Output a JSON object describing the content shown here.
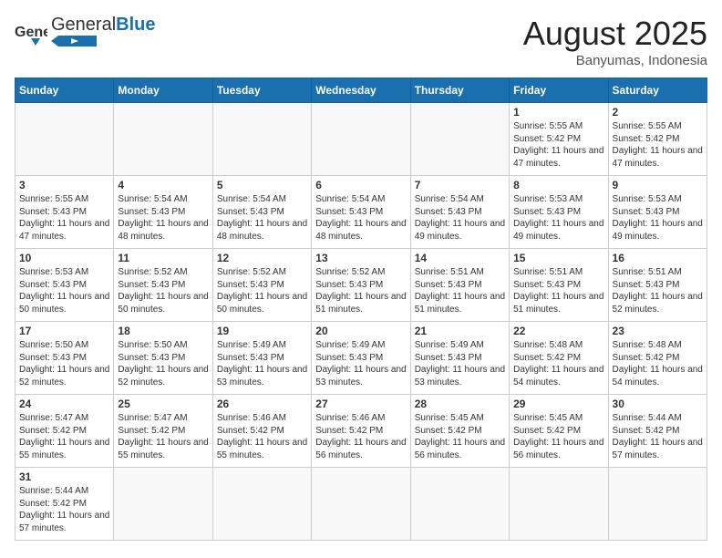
{
  "header": {
    "logo_general": "General",
    "logo_blue": "Blue",
    "month_title": "August 2025",
    "location": "Banyumas, Indonesia"
  },
  "days_of_week": [
    "Sunday",
    "Monday",
    "Tuesday",
    "Wednesday",
    "Thursday",
    "Friday",
    "Saturday"
  ],
  "weeks": [
    [
      {
        "day": "",
        "info": ""
      },
      {
        "day": "",
        "info": ""
      },
      {
        "day": "",
        "info": ""
      },
      {
        "day": "",
        "info": ""
      },
      {
        "day": "",
        "info": ""
      },
      {
        "day": "1",
        "info": "Sunrise: 5:55 AM\nSunset: 5:42 PM\nDaylight: 11 hours and 47 minutes."
      },
      {
        "day": "2",
        "info": "Sunrise: 5:55 AM\nSunset: 5:42 PM\nDaylight: 11 hours and 47 minutes."
      }
    ],
    [
      {
        "day": "3",
        "info": "Sunrise: 5:55 AM\nSunset: 5:43 PM\nDaylight: 11 hours and 47 minutes."
      },
      {
        "day": "4",
        "info": "Sunrise: 5:54 AM\nSunset: 5:43 PM\nDaylight: 11 hours and 48 minutes."
      },
      {
        "day": "5",
        "info": "Sunrise: 5:54 AM\nSunset: 5:43 PM\nDaylight: 11 hours and 48 minutes."
      },
      {
        "day": "6",
        "info": "Sunrise: 5:54 AM\nSunset: 5:43 PM\nDaylight: 11 hours and 48 minutes."
      },
      {
        "day": "7",
        "info": "Sunrise: 5:54 AM\nSunset: 5:43 PM\nDaylight: 11 hours and 49 minutes."
      },
      {
        "day": "8",
        "info": "Sunrise: 5:53 AM\nSunset: 5:43 PM\nDaylight: 11 hours and 49 minutes."
      },
      {
        "day": "9",
        "info": "Sunrise: 5:53 AM\nSunset: 5:43 PM\nDaylight: 11 hours and 49 minutes."
      }
    ],
    [
      {
        "day": "10",
        "info": "Sunrise: 5:53 AM\nSunset: 5:43 PM\nDaylight: 11 hours and 50 minutes."
      },
      {
        "day": "11",
        "info": "Sunrise: 5:52 AM\nSunset: 5:43 PM\nDaylight: 11 hours and 50 minutes."
      },
      {
        "day": "12",
        "info": "Sunrise: 5:52 AM\nSunset: 5:43 PM\nDaylight: 11 hours and 50 minutes."
      },
      {
        "day": "13",
        "info": "Sunrise: 5:52 AM\nSunset: 5:43 PM\nDaylight: 11 hours and 51 minutes."
      },
      {
        "day": "14",
        "info": "Sunrise: 5:51 AM\nSunset: 5:43 PM\nDaylight: 11 hours and 51 minutes."
      },
      {
        "day": "15",
        "info": "Sunrise: 5:51 AM\nSunset: 5:43 PM\nDaylight: 11 hours and 51 minutes."
      },
      {
        "day": "16",
        "info": "Sunrise: 5:51 AM\nSunset: 5:43 PM\nDaylight: 11 hours and 52 minutes."
      }
    ],
    [
      {
        "day": "17",
        "info": "Sunrise: 5:50 AM\nSunset: 5:43 PM\nDaylight: 11 hours and 52 minutes."
      },
      {
        "day": "18",
        "info": "Sunrise: 5:50 AM\nSunset: 5:43 PM\nDaylight: 11 hours and 52 minutes."
      },
      {
        "day": "19",
        "info": "Sunrise: 5:49 AM\nSunset: 5:43 PM\nDaylight: 11 hours and 53 minutes."
      },
      {
        "day": "20",
        "info": "Sunrise: 5:49 AM\nSunset: 5:43 PM\nDaylight: 11 hours and 53 minutes."
      },
      {
        "day": "21",
        "info": "Sunrise: 5:49 AM\nSunset: 5:43 PM\nDaylight: 11 hours and 53 minutes."
      },
      {
        "day": "22",
        "info": "Sunrise: 5:48 AM\nSunset: 5:42 PM\nDaylight: 11 hours and 54 minutes."
      },
      {
        "day": "23",
        "info": "Sunrise: 5:48 AM\nSunset: 5:42 PM\nDaylight: 11 hours and 54 minutes."
      }
    ],
    [
      {
        "day": "24",
        "info": "Sunrise: 5:47 AM\nSunset: 5:42 PM\nDaylight: 11 hours and 55 minutes."
      },
      {
        "day": "25",
        "info": "Sunrise: 5:47 AM\nSunset: 5:42 PM\nDaylight: 11 hours and 55 minutes."
      },
      {
        "day": "26",
        "info": "Sunrise: 5:46 AM\nSunset: 5:42 PM\nDaylight: 11 hours and 55 minutes."
      },
      {
        "day": "27",
        "info": "Sunrise: 5:46 AM\nSunset: 5:42 PM\nDaylight: 11 hours and 56 minutes."
      },
      {
        "day": "28",
        "info": "Sunrise: 5:45 AM\nSunset: 5:42 PM\nDaylight: 11 hours and 56 minutes."
      },
      {
        "day": "29",
        "info": "Sunrise: 5:45 AM\nSunset: 5:42 PM\nDaylight: 11 hours and 56 minutes."
      },
      {
        "day": "30",
        "info": "Sunrise: 5:44 AM\nSunset: 5:42 PM\nDaylight: 11 hours and 57 minutes."
      }
    ],
    [
      {
        "day": "31",
        "info": "Sunrise: 5:44 AM\nSunset: 5:42 PM\nDaylight: 11 hours and 57 minutes."
      },
      {
        "day": "",
        "info": ""
      },
      {
        "day": "",
        "info": ""
      },
      {
        "day": "",
        "info": ""
      },
      {
        "day": "",
        "info": ""
      },
      {
        "day": "",
        "info": ""
      },
      {
        "day": "",
        "info": ""
      }
    ]
  ]
}
